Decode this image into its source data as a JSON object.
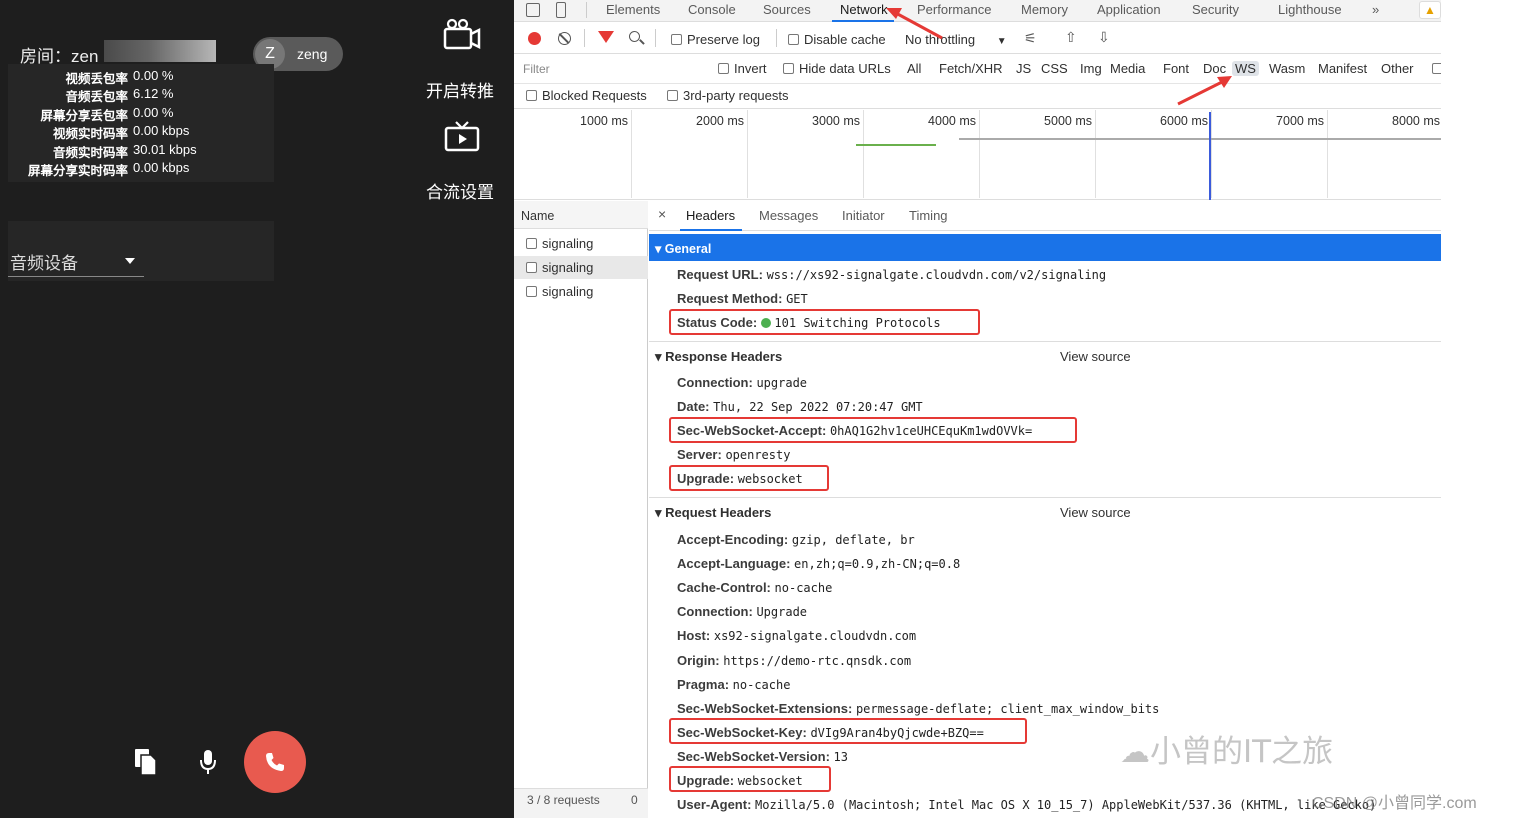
{
  "app": {
    "room_label": "房间：zen",
    "user_avatar": "Z",
    "user_name": "zeng",
    "stats": [
      {
        "label": "视频丢包率",
        "value": "0.00 %"
      },
      {
        "label": "音频丢包率",
        "value": "6.12 %"
      },
      {
        "label": "屏幕分享丢包率",
        "value": "0.00 %"
      },
      {
        "label": "视频实时码率",
        "value": "0.00 kbps"
      },
      {
        "label": "音频实时码率",
        "value": "30.01 kbps"
      },
      {
        "label": "屏幕分享实时码率",
        "value": "0.00 kbps"
      }
    ],
    "push_label": "开启转推",
    "merge_label": "合流设置",
    "audio_device_label": "音频设备",
    "icons": {
      "push": "camera-icon",
      "merge": "tv-icon",
      "copy": "copy-icon",
      "mic": "mic-icon",
      "hangup": "phone-icon"
    },
    "hangup_color": "#e85a4f"
  },
  "devtools": {
    "tabs": [
      "Elements",
      "Console",
      "Sources",
      "Network",
      "Performance",
      "Memory",
      "Application",
      "Security",
      "Lighthouse",
      "»"
    ],
    "active_tab": "Network",
    "toolbar": {
      "preserve_log": "Preserve log",
      "disable_cache": "Disable cache",
      "throttling": "No throttling"
    },
    "filter": {
      "placeholder": "Filter",
      "invert": "Invert",
      "hide_data_urls": "Hide data URLs",
      "types": [
        "All",
        "Fetch/XHR",
        "JS",
        "CSS",
        "Img",
        "Media",
        "Font",
        "Doc",
        "WS",
        "Wasm",
        "Manifest",
        "Other"
      ],
      "active_type": "WS",
      "blocked_requests": "Blocked Requests",
      "third_party": "3rd-party requests"
    },
    "timeline": [
      "1000 ms",
      "2000 ms",
      "3000 ms",
      "4000 ms",
      "5000 ms",
      "6000 ms",
      "7000 ms",
      "8000 ms"
    ],
    "name_header": "Name",
    "requests": [
      "signaling",
      "signaling",
      "signaling"
    ],
    "footer": "3 / 8 requests",
    "footer2": "0",
    "detail_tabs": [
      "Headers",
      "Messages",
      "Initiator",
      "Timing"
    ],
    "close_glyph": "×",
    "general": {
      "title": "General",
      "url_k": "Request URL:",
      "url_v": "wss://xs92-signalgate.cloudvdn.com/v2/signaling",
      "method_k": "Request Method:",
      "method_v": "GET",
      "status_k": "Status Code:",
      "status_v": "101 Switching Protocols"
    },
    "view_source": "View source",
    "response": {
      "title": "Response Headers",
      "items": [
        {
          "k": "Connection:",
          "v": "upgrade"
        },
        {
          "k": "Date:",
          "v": "Thu, 22 Sep 2022 07:20:47 GMT"
        },
        {
          "k": "Sec-WebSocket-Accept:",
          "v": "0hAQ1G2hv1ceUHCEquKm1wdOVVk="
        },
        {
          "k": "Server:",
          "v": "openresty"
        },
        {
          "k": "Upgrade:",
          "v": "websocket"
        }
      ]
    },
    "request": {
      "title": "Request Headers",
      "items": [
        {
          "k": "Accept-Encoding:",
          "v": "gzip, deflate, br"
        },
        {
          "k": "Accept-Language:",
          "v": "en,zh;q=0.9,zh-CN;q=0.8"
        },
        {
          "k": "Cache-Control:",
          "v": "no-cache"
        },
        {
          "k": "Connection:",
          "v": "Upgrade"
        },
        {
          "k": "Host:",
          "v": "xs92-signalgate.cloudvdn.com"
        },
        {
          "k": "Origin:",
          "v": "https://demo-rtc.qnsdk.com"
        },
        {
          "k": "Pragma:",
          "v": "no-cache"
        },
        {
          "k": "Sec-WebSocket-Extensions:",
          "v": "permessage-deflate; client_max_window_bits"
        },
        {
          "k": "Sec-WebSocket-Key:",
          "v": "dVIg9Aran4byQjcwde+BZQ=="
        },
        {
          "k": "Sec-WebSocket-Version:",
          "v": "13"
        },
        {
          "k": "Upgrade:",
          "v": "websocket"
        },
        {
          "k": "User-Agent:",
          "v": "Mozilla/5.0 (Macintosh; Intel Mac OS X 10_15_7) AppleWebKit/537.36 (KHTML, like Gecko)"
        }
      ]
    },
    "colors": {
      "general_bar": "#1a73e8",
      "annotation": "#e53935",
      "status_dot": "#4caf50"
    }
  },
  "watermark": {
    "text": "小曾的IT之旅",
    "credit": "CSDN @小曾同学.com"
  }
}
